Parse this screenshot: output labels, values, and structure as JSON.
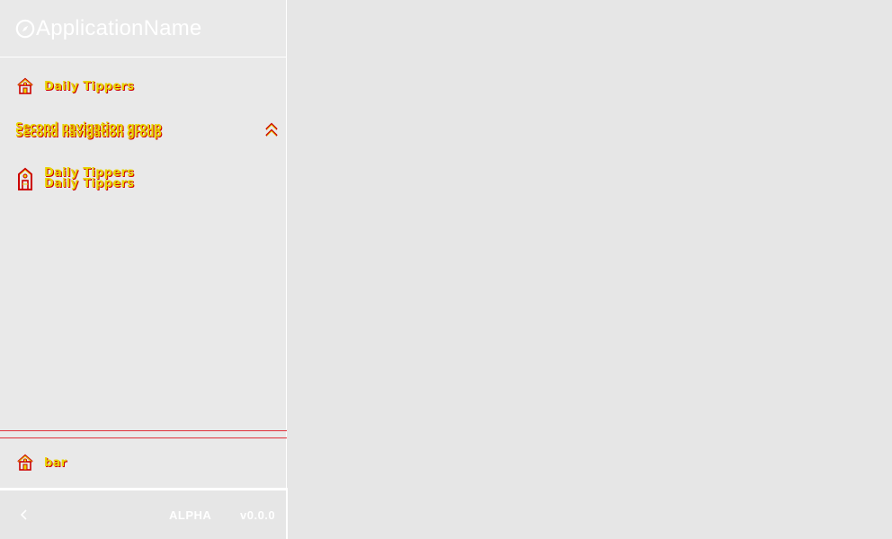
{
  "app": {
    "title": "ApplicationName",
    "logo_icon": "compass-icon"
  },
  "nav": {
    "items": [
      {
        "label": "Daily Tippers",
        "icon": "home-icon"
      }
    ],
    "group": {
      "label_line1": "Second navigation group",
      "label_line2": "Second navigation group",
      "chevron_icon": "chevron-up-double-icon",
      "items": [
        {
          "label_line1": "Daily Tippers",
          "label_line2": "Daily Tippers",
          "icon": "building-icon"
        }
      ]
    },
    "bottom_items": [
      {
        "label": "bar",
        "icon": "home-icon"
      }
    ]
  },
  "footer": {
    "collapse_icon": "chevron-left-icon",
    "stage": "ALPHA",
    "version": "v0.0.0"
  },
  "colors": {
    "label_fill": "#e8d400",
    "label_shadow": "#cc0000",
    "background": "#e6e6e6",
    "divider_red": "#e0303a"
  }
}
